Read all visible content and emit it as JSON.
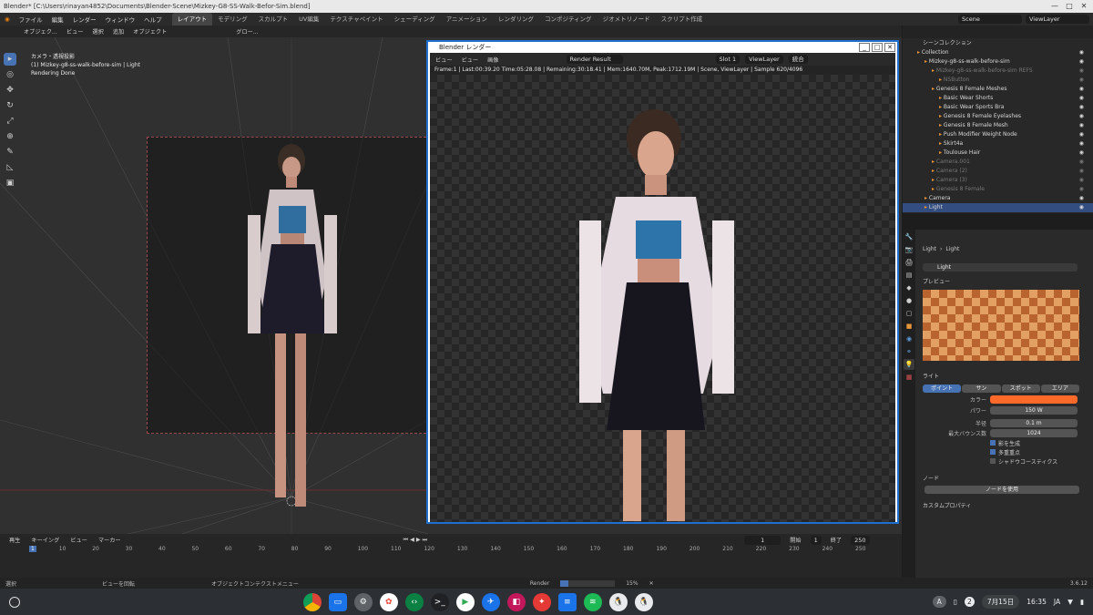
{
  "window": {
    "title": "Blender* [C:\\Users\\rinayan4852\\Documents\\Blender-Scene\\Mizkey-G8-SS-Walk-Befor-Sim.blend]"
  },
  "menu": [
    "ファイル",
    "編集",
    "レンダー",
    "ウィンドウ",
    "ヘルプ"
  ],
  "workspaces": [
    "レイアウト",
    "モデリング",
    "スカルプト",
    "UV編集",
    "テクスチャペイント",
    "シェーディング",
    "アニメーション",
    "レンダリング",
    "コンポジティング",
    "ジオメトリノード",
    "スクリプト作成"
  ],
  "scene": {
    "scene": "Scene",
    "view_layer": "ViewLayer"
  },
  "viewport": {
    "header": [
      "オブジェク...",
      "ビュー",
      "選択",
      "追加",
      "オブジェクト"
    ],
    "transform": "グロー...",
    "overlay_lines": [
      "カメラ・透視投影",
      "(1) Mizkey-g8-ss-walk-before-sim | Light",
      "Rendering Done"
    ]
  },
  "render_window": {
    "title": "Blender レンダー",
    "menus": [
      "ビュー",
      "ビュー",
      "画像"
    ],
    "image": "Render Result",
    "slot": "Slot 1",
    "layer": "ViewLayer",
    "pass": "統合",
    "stats": "Frame:1 | Last:00:39.20 Time:05:28.08 | Remaining:30:18.41 | Mem:1640.70M, Peak:1712.19M | Scene, ViewLayer | Sample 620/4096"
  },
  "outliner": {
    "header": "シーンコレクション",
    "rows": [
      {
        "label": "Collection",
        "indent": 1
      },
      {
        "label": "Mizkey-g8-ss-walk-before-sim",
        "indent": 2
      },
      {
        "label": "Mizkey-g8-ss-walk-before-sim REFS",
        "indent": 3,
        "dim": true
      },
      {
        "label": "NSButton",
        "indent": 4,
        "dim": true
      },
      {
        "label": "Genesis 8 Female Meshes",
        "indent": 3
      },
      {
        "label": "Basic Wear Shorts",
        "indent": 4
      },
      {
        "label": "Basic Wear Sports Bra",
        "indent": 4
      },
      {
        "label": "Genesis 8 Female Eyelashes",
        "indent": 4
      },
      {
        "label": "Genesis 8 Female Mesh",
        "indent": 4
      },
      {
        "label": "Push Modifier Weight Node",
        "indent": 4
      },
      {
        "label": "Skirt4a",
        "indent": 4
      },
      {
        "label": "Toulouse Hair",
        "indent": 4
      },
      {
        "label": "Camera.001",
        "indent": 3,
        "dim": true
      },
      {
        "label": "Camera (2)",
        "indent": 3,
        "dim": true
      },
      {
        "label": "Camera (3)",
        "indent": 3,
        "dim": true
      },
      {
        "label": "Genesis 8 Female",
        "indent": 3,
        "dim": true
      },
      {
        "label": "Camera",
        "indent": 2
      },
      {
        "label": "Light",
        "indent": 2,
        "selected": true
      }
    ]
  },
  "properties": {
    "breadcrumb": [
      "Light",
      "Light"
    ],
    "datablock": "Light",
    "preview_label": "プレビュー",
    "light_label": "ライト",
    "light_types": [
      "ポイント",
      "サン",
      "スポット",
      "エリア"
    ],
    "color_label": "カラー",
    "color": "#ff6a2a",
    "power_label": "パワー",
    "power": "150 W",
    "radius_label": "半径",
    "radius": "0.1 m",
    "bounces_label": "最大バウンス数",
    "bounces": "1024",
    "checks": [
      "影を生成",
      "多重重点",
      "シャドウコースティクス"
    ],
    "nodes_label": "ノード",
    "use_nodes": "ノードを使用",
    "custom_props": "カスタムプロパティ"
  },
  "timeline": {
    "menus": [
      "再生",
      "キーイング",
      "ビュー",
      "マーカー"
    ],
    "current": "1",
    "start_label": "開始",
    "start": "1",
    "end_label": "終了",
    "end": "250",
    "ticks": [
      "1",
      "10",
      "20",
      "30",
      "40",
      "50",
      "60",
      "70",
      "80",
      "90",
      "100",
      "110",
      "120",
      "130",
      "140",
      "150",
      "160",
      "170",
      "180",
      "190",
      "200",
      "210",
      "220",
      "230",
      "240",
      "250"
    ]
  },
  "status": {
    "select": "選択",
    "rotate": "ビューを回転",
    "context": "オブジェクトコンテクストメニュー",
    "render": "Render",
    "progress": "15%",
    "version": "3.6.12"
  },
  "shelf": {
    "date": "7月15日",
    "time": "16:35",
    "lang": "JA",
    "badge": "2"
  }
}
